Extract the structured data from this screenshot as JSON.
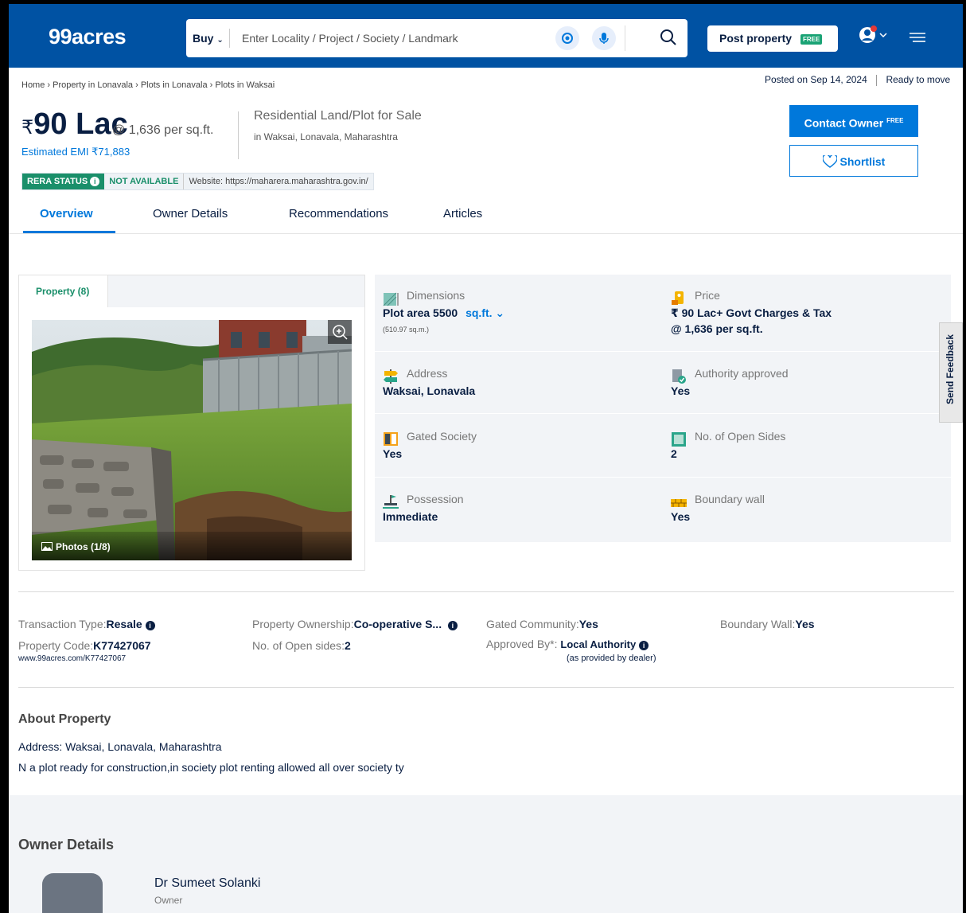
{
  "header": {
    "logo": "99acres",
    "buy_label": "Buy",
    "search_placeholder": "Enter Locality / Project / Society / Landmark",
    "post_property_label": "Post property",
    "free_badge": "FREE",
    "brand_color": "#0052A3"
  },
  "breadcrumb": [
    "Home",
    "Property in Lonavala",
    "Plots in Lonavala",
    "Plots in Waksai"
  ],
  "posted_on": "Posted on Sep 14, 2024",
  "ready_to_move": "Ready to move",
  "price": {
    "currency": "₹",
    "amount": "90 Lac",
    "per_sqft": "@ 1,636 per sq.ft.",
    "emi": "Estimated EMI ₹71,883"
  },
  "property_type": "Residential Land/Plot for Sale",
  "property_location": "in Waksai, Lonavala, Maharashtra",
  "rera": {
    "status_label": "RERA STATUS",
    "status_value": "NOT AVAILABLE",
    "website": "Website: https://maharera.maharashtra.gov.in/"
  },
  "actions": {
    "contact_owner": "Contact Owner",
    "contact_free": "FREE",
    "shortlist": "Shortlist"
  },
  "tabs": [
    "Overview",
    "Owner Details",
    "Recommendations",
    "Articles"
  ],
  "gallery": {
    "tab_label": "Property (8)",
    "caption": "Photos (1/8)"
  },
  "details": {
    "dimensions_label": "Dimensions",
    "dimensions_value": "Plot area 5500",
    "dimensions_unit": "sq.ft.",
    "dimensions_sub": "(510.97 sq.m.)",
    "price_label": "Price",
    "price_value": "₹ 90 Lac+ Govt Charges & Tax",
    "price_sub": "@ 1,636 per sq.ft.",
    "address_label": "Address",
    "address_value": "Waksai, Lonavala",
    "authority_label": "Authority approved",
    "authority_value": "Yes",
    "gated_label": "Gated Society",
    "gated_value": "Yes",
    "open_sides_label": "No. of Open Sides",
    "open_sides_value": "2",
    "possession_label": "Possession",
    "possession_value": "Immediate",
    "boundary_label": "Boundary wall",
    "boundary_value": "Yes"
  },
  "feedback": "Send Feedback",
  "summary": {
    "transaction_label": "Transaction Type",
    "transaction_value": "Resale",
    "ownership_label": "Property Ownership",
    "ownership_value": "Co-operative S...",
    "gated_comm_label": "Gated Community",
    "gated_comm_value": "Yes",
    "boundary_label": "Boundary Wall",
    "boundary_value": "Yes",
    "code_label": "Property Code",
    "code_value": "K77427067",
    "code_url": "www.99acres.com/K77427067",
    "open_sides_label": "No. of Open sides",
    "open_sides_value": "2",
    "approved_label": "Approved By*",
    "approved_value": "Local Authority",
    "approved_note": "(as provided by dealer)"
  },
  "about": {
    "heading": "About Property",
    "address_label": "Address:",
    "address_value": "Waksai, Lonavala, Maharashtra",
    "description": "N a plot ready for construction,in society plot renting allowed all over society ty"
  },
  "owner": {
    "heading": "Owner Details",
    "name": "Dr Sumeet Solanki",
    "role": "Owner"
  }
}
